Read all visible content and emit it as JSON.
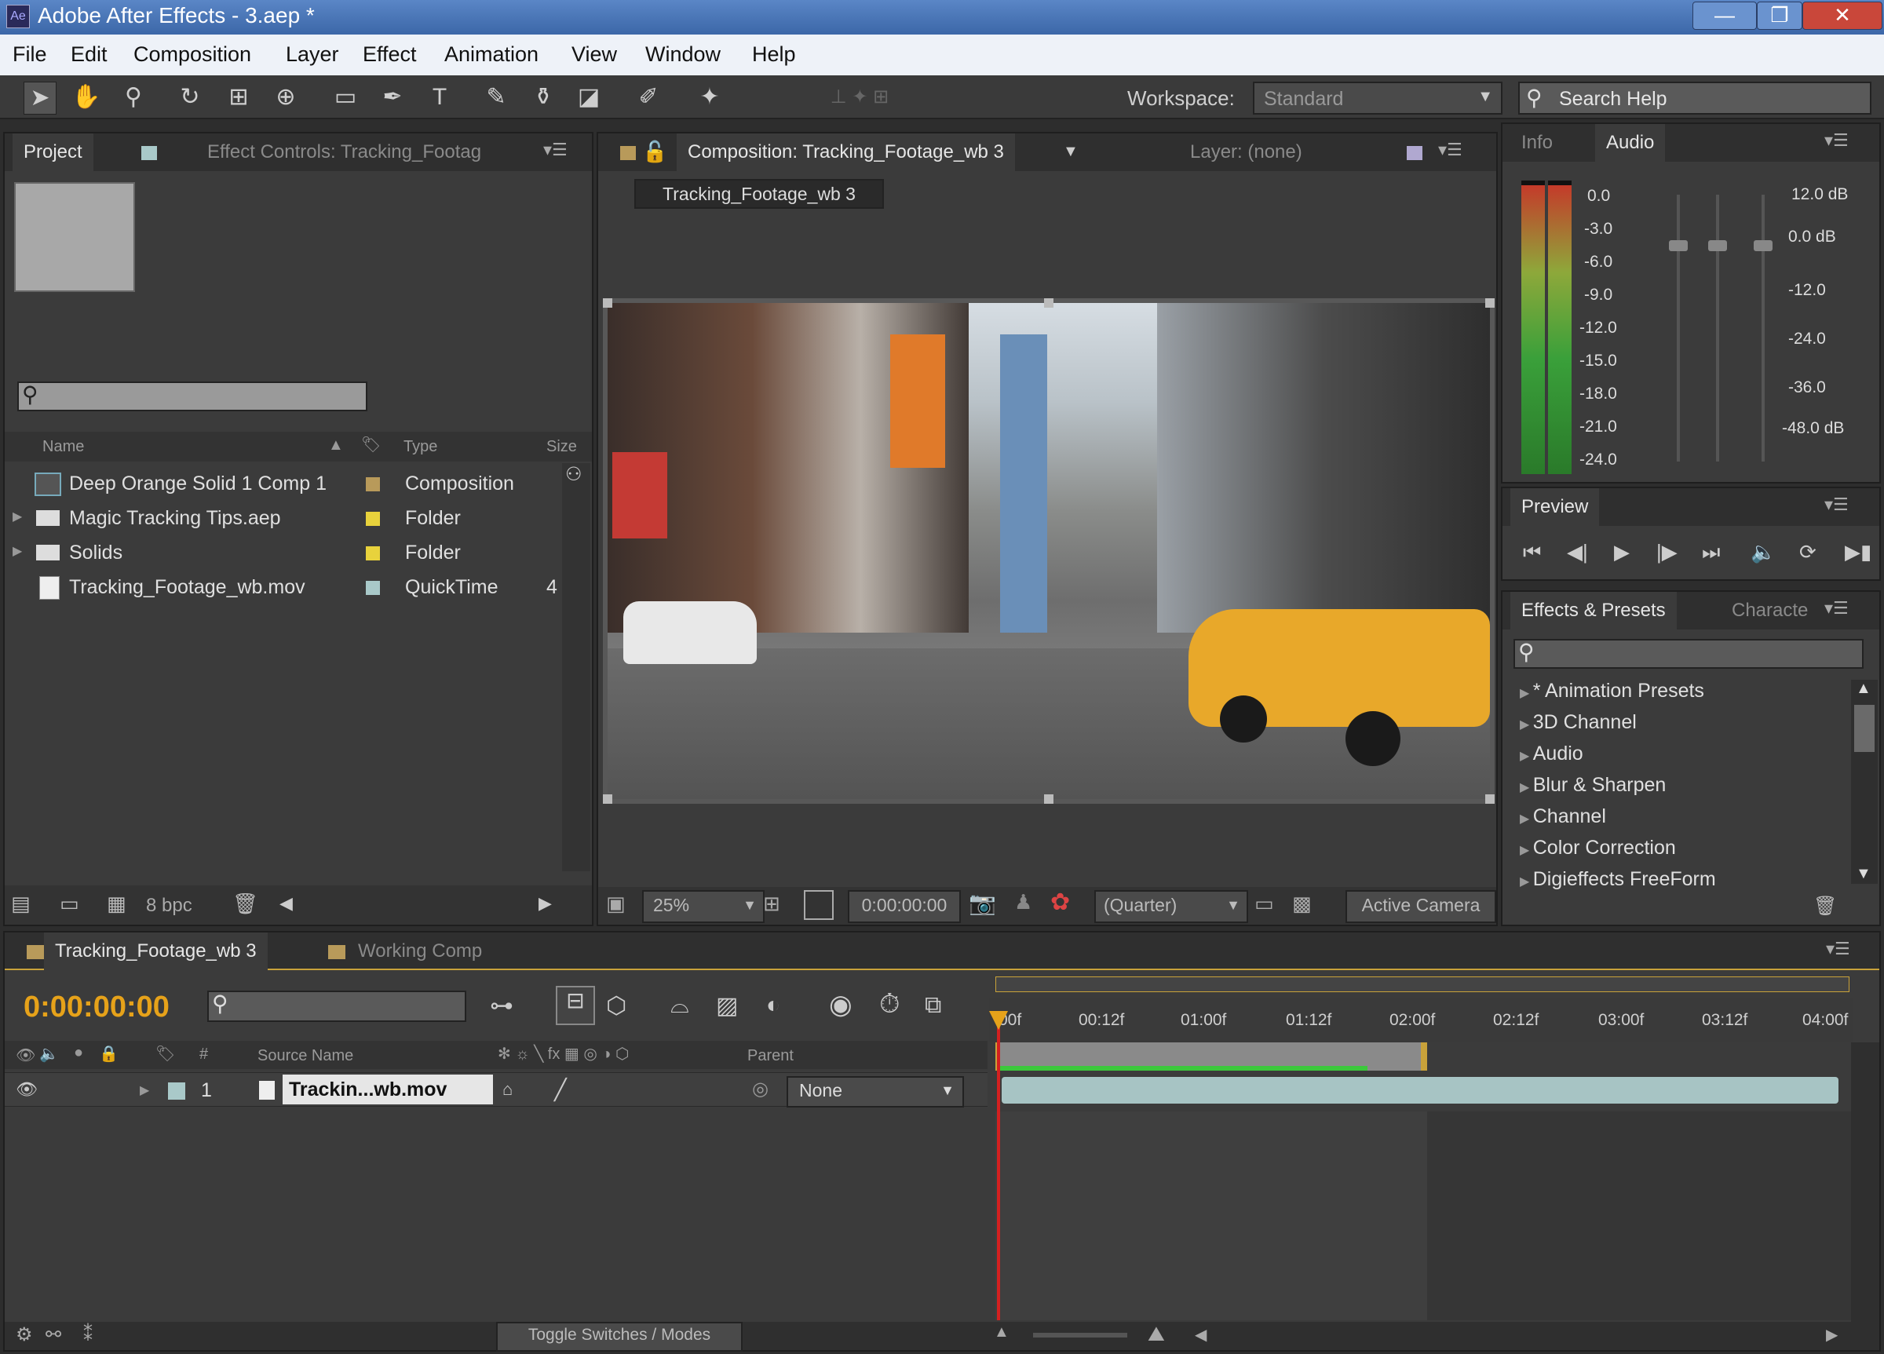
{
  "window": {
    "title": "Adobe After Effects - 3.aep *",
    "app_icon": "after-effects-icon",
    "minimize": "—",
    "maximize": "❐",
    "close": "✕"
  },
  "menu": [
    "File",
    "Edit",
    "Composition",
    "Layer",
    "Effect",
    "Animation",
    "View",
    "Window",
    "Help"
  ],
  "toolbar": {
    "tools": [
      "selection-tool-icon",
      "hand-tool-icon",
      "zoom-tool-icon",
      "rotation-tool-icon",
      "camera-tool-icon",
      "pan-behind-tool-icon",
      "rectangle-tool-icon",
      "pen-tool-icon",
      "type-tool-icon",
      "brush-tool-icon",
      "clone-stamp-icon",
      "eraser-icon",
      "roto-brush-icon",
      "puppet-pin-icon"
    ],
    "workspace_label": "Workspace:",
    "workspace_value": "Standard",
    "search_placeholder": "Search Help"
  },
  "project_panel": {
    "tabs": [
      "Project",
      "Effect Controls: Tracking_Footag"
    ],
    "columns": {
      "name": "Name",
      "type": "Type",
      "size": "Size"
    },
    "items": [
      {
        "name": "Deep Orange Solid 1 Comp 1",
        "type": "Composition",
        "icon": "composition-icon",
        "color": "#b89a5a",
        "size": ""
      },
      {
        "name": "Magic Tracking Tips.aep",
        "type": "Folder",
        "icon": "folder-icon",
        "color": "#e8d23c",
        "size": ""
      },
      {
        "name": "Solids",
        "type": "Folder",
        "icon": "folder-icon",
        "color": "#e8d23c",
        "size": ""
      },
      {
        "name": "Tracking_Footage_wb.mov",
        "type": "QuickTime",
        "icon": "footage-icon",
        "color": "#a9c9c9",
        "size": "4"
      }
    ],
    "bpc": "8 bpc"
  },
  "composition_panel": {
    "tab": "Composition: Tracking_Footage_wb 3",
    "layer_tab": "Layer: (none)",
    "comp_button": "Tracking_Footage_wb 3",
    "zoom": "25%",
    "timecode": "0:00:00:00",
    "resolution": "(Quarter)",
    "camera": "Active Camera"
  },
  "audio_panel": {
    "tabs": [
      "Info",
      "Audio"
    ],
    "left_scale": [
      "0.0",
      "-3.0",
      "-6.0",
      "-9.0",
      "-12.0",
      "-15.0",
      "-18.0",
      "-21.0",
      "-24.0"
    ],
    "right_scale": [
      "12.0 dB",
      "0.0 dB",
      "-12.0",
      "-24.0",
      "-36.0",
      "-48.0 dB"
    ]
  },
  "preview_panel": {
    "title": "Preview",
    "buttons": [
      "first-frame-icon",
      "previous-frame-icon",
      "play-icon",
      "next-frame-icon",
      "last-frame-icon",
      "audio-icon",
      "loop-icon",
      "ram-preview-icon"
    ]
  },
  "effects_panel": {
    "tabs": [
      "Effects & Presets",
      "Characte"
    ],
    "items": [
      "* Animation Presets",
      "3D Channel",
      "Audio",
      "Blur & Sharpen",
      "Channel",
      "Color Correction",
      "Digieffects FreeForm"
    ]
  },
  "timeline": {
    "tabs": [
      "Tracking_Footage_wb 3",
      "Working Comp"
    ],
    "timecode": "0:00:00:00",
    "columns": {
      "source_name": "Source Name",
      "parent": "Parent",
      "number": "#"
    },
    "ruler": [
      "00f",
      "00:12f",
      "01:00f",
      "01:12f",
      "02:00f",
      "02:12f",
      "03:00f",
      "03:12f",
      "04:00f"
    ],
    "layer": {
      "number": "1",
      "name": "Trackin...wb.mov",
      "parent": "None"
    },
    "toggle_label": "Toggle Switches / Modes"
  },
  "colors": {
    "timecode": "#e6a21a",
    "playhead": "#d42020",
    "work_area": "#3cc83c",
    "layer_bar": "#a7c4c4"
  }
}
